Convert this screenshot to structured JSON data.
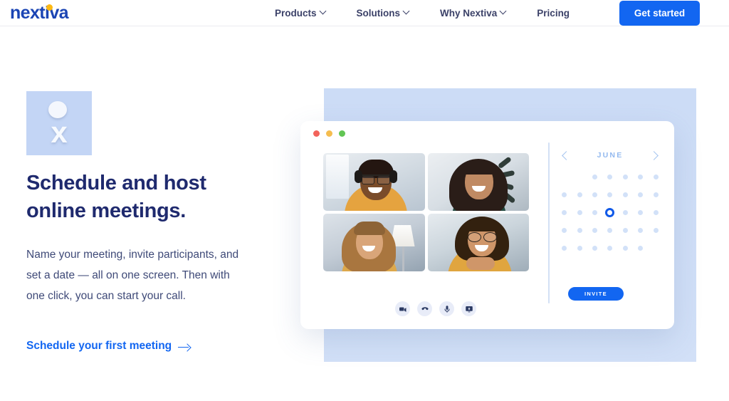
{
  "header": {
    "logo_text": "nextiva",
    "logo_colors": {
      "text": "#1b45b4",
      "dot": "#fdb913"
    },
    "nav_items": [
      {
        "label": "Products",
        "has_dropdown": true
      },
      {
        "label": "Solutions",
        "has_dropdown": true
      },
      {
        "label": "Why Nextiva",
        "has_dropdown": true
      },
      {
        "label": "Pricing",
        "has_dropdown": false
      }
    ],
    "cta_button": {
      "label": "Get started",
      "color": "#1266f1"
    }
  },
  "hero": {
    "icon_alt": "meeting-person-icon",
    "headline": "Schedule and host online meetings.",
    "body": "Name your meeting, invite participants, and set a date — all on one screen. Then with one click, you can start your call.",
    "link_label": "Schedule your first meeting",
    "heading_color": "#1f2a6e",
    "link_color": "#1266f1"
  },
  "mockup": {
    "window_dots": [
      "red",
      "amber",
      "green"
    ],
    "participants": [
      {
        "id": 1,
        "description": "man with headset and glasses in orange sweater"
      },
      {
        "id": 2,
        "description": "woman with long dark hair in green top"
      },
      {
        "id": 3,
        "description": "woman with blonde wavy hair in mustard top"
      },
      {
        "id": 4,
        "description": "woman with glasses in mustard top, hands clasped"
      }
    ],
    "controls": [
      {
        "name": "video-camera",
        "label": "Camera"
      },
      {
        "name": "hangup-phone",
        "label": "End call"
      },
      {
        "name": "microphone",
        "label": "Microphone"
      },
      {
        "name": "screen-share",
        "label": "Share screen"
      }
    ],
    "calendar": {
      "month": "JUNE",
      "prev_label": "Previous month",
      "next_label": "Next month",
      "rows": [
        [
          false,
          false,
          true,
          true,
          true,
          true,
          true
        ],
        [
          true,
          true,
          true,
          true,
          true,
          true,
          true
        ],
        [
          true,
          true,
          true,
          true,
          true,
          true,
          true
        ],
        [
          true,
          true,
          true,
          true,
          true,
          true,
          true
        ],
        [
          true,
          true,
          true,
          true,
          true,
          true,
          false
        ]
      ],
      "selected": {
        "row": 2,
        "col": 3
      },
      "dot_color": "#d2e1f8",
      "selected_color": "#1059e8"
    },
    "invite_button": {
      "label": "INVITE",
      "color": "#1266f1"
    },
    "panel_color": "#ccdcf6"
  }
}
